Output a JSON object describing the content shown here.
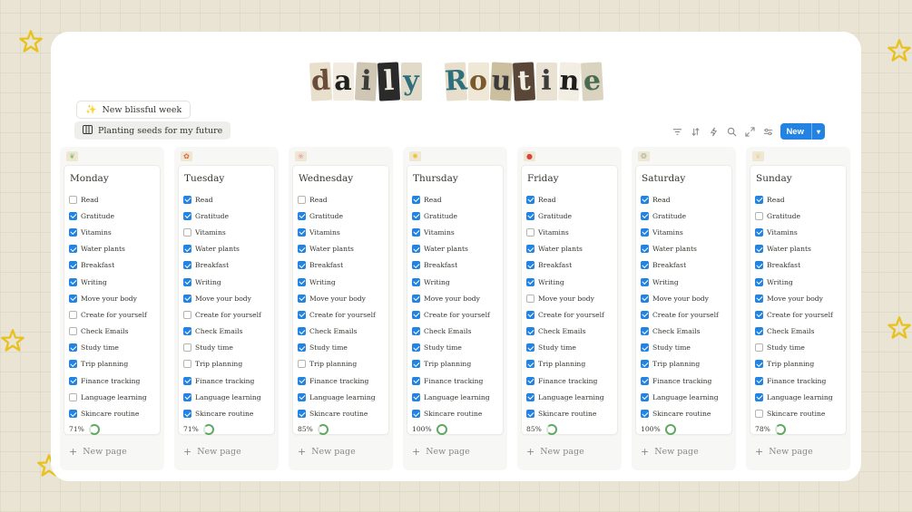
{
  "title": {
    "word1": [
      "d",
      "a",
      "i",
      "l",
      "y"
    ],
    "word2": [
      "R",
      "o",
      "u",
      "t",
      "i",
      "n",
      "e"
    ]
  },
  "week_pill": {
    "label": "New blissful week",
    "icon": "sparkles-icon"
  },
  "view_tab": {
    "label": "Planting seeds for my future",
    "icon": "board-view-icon"
  },
  "toolbar": {
    "icons": [
      "filter-icon",
      "sort-icon",
      "lightning-icon",
      "search-icon",
      "expand-icon",
      "settings-icon"
    ],
    "new_label": "New",
    "accent": "#2383e2"
  },
  "days": [
    {
      "name": "Monday",
      "progress": "71%",
      "tasks": [
        {
          "label": "Read",
          "done": false
        },
        {
          "label": "Gratitude",
          "done": true
        },
        {
          "label": "Vitamins",
          "done": true
        },
        {
          "label": "Water plants",
          "done": true
        },
        {
          "label": "Breakfast",
          "done": true
        },
        {
          "label": "Writing",
          "done": true
        },
        {
          "label": "Move your body",
          "done": true
        },
        {
          "label": "Create for yourself",
          "done": false
        },
        {
          "label": "Check Emails",
          "done": false
        },
        {
          "label": "Study time",
          "done": true
        },
        {
          "label": "Trip planning",
          "done": true
        },
        {
          "label": "Finance tracking",
          "done": true
        },
        {
          "label": "Language learning",
          "done": false
        },
        {
          "label": "Skincare routine",
          "done": true
        }
      ]
    },
    {
      "name": "Tuesday",
      "progress": "71%",
      "tasks": [
        {
          "label": "Read",
          "done": true
        },
        {
          "label": "Gratitude",
          "done": true
        },
        {
          "label": "Vitamins",
          "done": false
        },
        {
          "label": "Water plants",
          "done": true
        },
        {
          "label": "Breakfast",
          "done": true
        },
        {
          "label": "Writing",
          "done": true
        },
        {
          "label": "Move your body",
          "done": true
        },
        {
          "label": "Create for yourself",
          "done": false
        },
        {
          "label": "Check Emails",
          "done": true
        },
        {
          "label": "Study time",
          "done": false
        },
        {
          "label": "Trip planning",
          "done": false
        },
        {
          "label": "Finance tracking",
          "done": true
        },
        {
          "label": "Language learning",
          "done": true
        },
        {
          "label": "Skincare routine",
          "done": true
        }
      ]
    },
    {
      "name": "Wednesday",
      "progress": "85%",
      "tasks": [
        {
          "label": "Read",
          "done": false
        },
        {
          "label": "Gratitude",
          "done": true
        },
        {
          "label": "Vitamins",
          "done": true
        },
        {
          "label": "Water plants",
          "done": true
        },
        {
          "label": "Breakfast",
          "done": true
        },
        {
          "label": "Writing",
          "done": true
        },
        {
          "label": "Move your body",
          "done": true
        },
        {
          "label": "Create for yourself",
          "done": true
        },
        {
          "label": "Check Emails",
          "done": true
        },
        {
          "label": "Study time",
          "done": true
        },
        {
          "label": "Trip planning",
          "done": false
        },
        {
          "label": "Finance tracking",
          "done": true
        },
        {
          "label": "Language learning",
          "done": true
        },
        {
          "label": "Skincare routine",
          "done": true
        }
      ]
    },
    {
      "name": "Thursday",
      "progress": "100%",
      "tasks": [
        {
          "label": "Read",
          "done": true
        },
        {
          "label": "Gratitude",
          "done": true
        },
        {
          "label": "Vitamins",
          "done": true
        },
        {
          "label": "Water plants",
          "done": true
        },
        {
          "label": "Breakfast",
          "done": true
        },
        {
          "label": "Writing",
          "done": true
        },
        {
          "label": "Move your body",
          "done": true
        },
        {
          "label": "Create for yourself",
          "done": true
        },
        {
          "label": "Check Emails",
          "done": true
        },
        {
          "label": "Study time",
          "done": true
        },
        {
          "label": "Trip planning",
          "done": true
        },
        {
          "label": "Finance tracking",
          "done": true
        },
        {
          "label": "Language learning",
          "done": true
        },
        {
          "label": "Skincare routine",
          "done": true
        }
      ]
    },
    {
      "name": "Friday",
      "progress": "85%",
      "tasks": [
        {
          "label": "Read",
          "done": true
        },
        {
          "label": "Gratitude",
          "done": true
        },
        {
          "label": "Vitamins",
          "done": false
        },
        {
          "label": "Water plants",
          "done": true
        },
        {
          "label": "Breakfast",
          "done": true
        },
        {
          "label": "Writing",
          "done": true
        },
        {
          "label": "Move your body",
          "done": false
        },
        {
          "label": "Create for yourself",
          "done": true
        },
        {
          "label": "Check Emails",
          "done": true
        },
        {
          "label": "Study time",
          "done": true
        },
        {
          "label": "Trip planning",
          "done": true
        },
        {
          "label": "Finance tracking",
          "done": true
        },
        {
          "label": "Language learning",
          "done": true
        },
        {
          "label": "Skincare routine",
          "done": true
        }
      ]
    },
    {
      "name": "Saturday",
      "progress": "100%",
      "tasks": [
        {
          "label": "Read",
          "done": true
        },
        {
          "label": "Gratitude",
          "done": true
        },
        {
          "label": "Vitamins",
          "done": true
        },
        {
          "label": "Water plants",
          "done": true
        },
        {
          "label": "Breakfast",
          "done": true
        },
        {
          "label": "Writing",
          "done": true
        },
        {
          "label": "Move your body",
          "done": true
        },
        {
          "label": "Create for yourself",
          "done": true
        },
        {
          "label": "Check Emails",
          "done": true
        },
        {
          "label": "Study time",
          "done": true
        },
        {
          "label": "Trip planning",
          "done": true
        },
        {
          "label": "Finance tracking",
          "done": true
        },
        {
          "label": "Language learning",
          "done": true
        },
        {
          "label": "Skincare routine",
          "done": true
        }
      ]
    },
    {
      "name": "Sunday",
      "progress": "78%",
      "tasks": [
        {
          "label": "Read",
          "done": true
        },
        {
          "label": "Gratitude",
          "done": false
        },
        {
          "label": "Vitamins",
          "done": true
        },
        {
          "label": "Water plants",
          "done": true
        },
        {
          "label": "Breakfast",
          "done": true
        },
        {
          "label": "Writing",
          "done": true
        },
        {
          "label": "Move your body",
          "done": true
        },
        {
          "label": "Create for yourself",
          "done": true
        },
        {
          "label": "Check Emails",
          "done": true
        },
        {
          "label": "Study time",
          "done": false
        },
        {
          "label": "Trip planning",
          "done": true
        },
        {
          "label": "Finance tracking",
          "done": true
        },
        {
          "label": "Language learning",
          "done": true
        },
        {
          "label": "Skincare routine",
          "done": false
        }
      ]
    }
  ],
  "new_page_label": "New page",
  "colors": {
    "checkbox": "#2383e2",
    "progress_ring": "#5fa862",
    "background": "#e9e4d3"
  }
}
